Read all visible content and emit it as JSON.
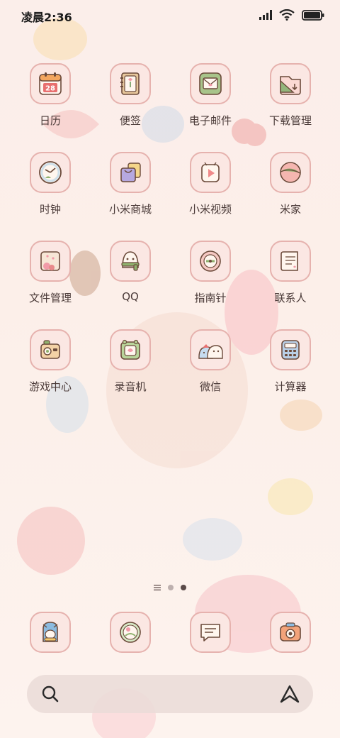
{
  "status_bar": {
    "time": "凌晨2:36",
    "battery_level": 1.0
  },
  "apps": [
    {
      "label": "日历",
      "icon": "calendar-icon",
      "badge": "28"
    },
    {
      "label": "便签",
      "icon": "notes-icon"
    },
    {
      "label": "电子邮件",
      "icon": "email-icon"
    },
    {
      "label": "下载管理",
      "icon": "download-icon"
    },
    {
      "label": "时钟",
      "icon": "clock-icon"
    },
    {
      "label": "小米商城",
      "icon": "shopping-bag-icon"
    },
    {
      "label": "小米视频",
      "icon": "video-play-icon"
    },
    {
      "label": "米家",
      "icon": "home-ball-icon"
    },
    {
      "label": "文件管理",
      "icon": "folder-icon"
    },
    {
      "label": "QQ",
      "icon": "penguin-icon"
    },
    {
      "label": "指南针",
      "icon": "compass-icon"
    },
    {
      "label": "联系人",
      "icon": "contacts-scroll-icon"
    },
    {
      "label": "游戏中心",
      "icon": "game-camera-icon"
    },
    {
      "label": "录音机",
      "icon": "recorder-icon"
    },
    {
      "label": "微信",
      "icon": "wechat-icon"
    },
    {
      "label": "计算器",
      "icon": "calculator-icon"
    }
  ],
  "page_indicator": {
    "pages": 2,
    "current": 2
  },
  "dock": [
    {
      "icon": "cat-app-icon"
    },
    {
      "icon": "browser-globe-icon"
    },
    {
      "icon": "messages-icon"
    },
    {
      "icon": "camera-icon"
    }
  ],
  "colors": {
    "tile_bg": "#fbe7e3",
    "tile_border": "#e6b2ae",
    "label": "#4a3a38"
  }
}
